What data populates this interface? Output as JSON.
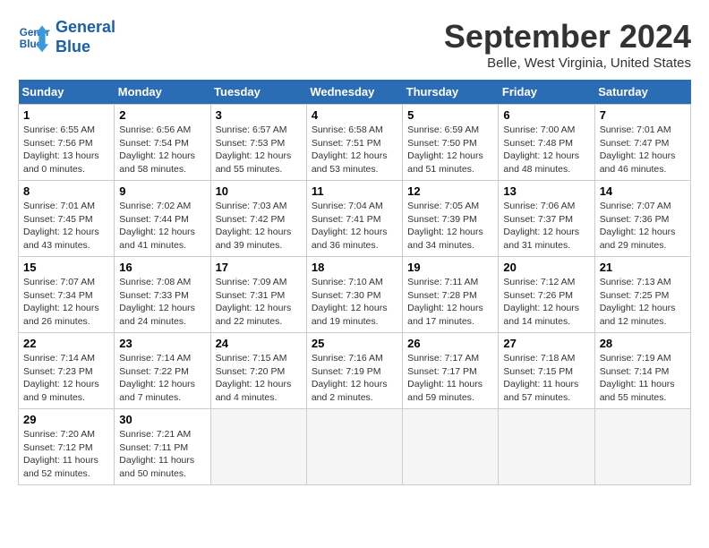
{
  "header": {
    "logo_line1": "General",
    "logo_line2": "Blue",
    "title": "September 2024",
    "subtitle": "Belle, West Virginia, United States"
  },
  "days_of_week": [
    "Sunday",
    "Monday",
    "Tuesday",
    "Wednesday",
    "Thursday",
    "Friday",
    "Saturday"
  ],
  "weeks": [
    [
      {
        "day": "1",
        "info": "Sunrise: 6:55 AM\nSunset: 7:56 PM\nDaylight: 13 hours\nand 0 minutes."
      },
      {
        "day": "2",
        "info": "Sunrise: 6:56 AM\nSunset: 7:54 PM\nDaylight: 12 hours\nand 58 minutes."
      },
      {
        "day": "3",
        "info": "Sunrise: 6:57 AM\nSunset: 7:53 PM\nDaylight: 12 hours\nand 55 minutes."
      },
      {
        "day": "4",
        "info": "Sunrise: 6:58 AM\nSunset: 7:51 PM\nDaylight: 12 hours\nand 53 minutes."
      },
      {
        "day": "5",
        "info": "Sunrise: 6:59 AM\nSunset: 7:50 PM\nDaylight: 12 hours\nand 51 minutes."
      },
      {
        "day": "6",
        "info": "Sunrise: 7:00 AM\nSunset: 7:48 PM\nDaylight: 12 hours\nand 48 minutes."
      },
      {
        "day": "7",
        "info": "Sunrise: 7:01 AM\nSunset: 7:47 PM\nDaylight: 12 hours\nand 46 minutes."
      }
    ],
    [
      {
        "day": "8",
        "info": "Sunrise: 7:01 AM\nSunset: 7:45 PM\nDaylight: 12 hours\nand 43 minutes."
      },
      {
        "day": "9",
        "info": "Sunrise: 7:02 AM\nSunset: 7:44 PM\nDaylight: 12 hours\nand 41 minutes."
      },
      {
        "day": "10",
        "info": "Sunrise: 7:03 AM\nSunset: 7:42 PM\nDaylight: 12 hours\nand 39 minutes."
      },
      {
        "day": "11",
        "info": "Sunrise: 7:04 AM\nSunset: 7:41 PM\nDaylight: 12 hours\nand 36 minutes."
      },
      {
        "day": "12",
        "info": "Sunrise: 7:05 AM\nSunset: 7:39 PM\nDaylight: 12 hours\nand 34 minutes."
      },
      {
        "day": "13",
        "info": "Sunrise: 7:06 AM\nSunset: 7:37 PM\nDaylight: 12 hours\nand 31 minutes."
      },
      {
        "day": "14",
        "info": "Sunrise: 7:07 AM\nSunset: 7:36 PM\nDaylight: 12 hours\nand 29 minutes."
      }
    ],
    [
      {
        "day": "15",
        "info": "Sunrise: 7:07 AM\nSunset: 7:34 PM\nDaylight: 12 hours\nand 26 minutes."
      },
      {
        "day": "16",
        "info": "Sunrise: 7:08 AM\nSunset: 7:33 PM\nDaylight: 12 hours\nand 24 minutes."
      },
      {
        "day": "17",
        "info": "Sunrise: 7:09 AM\nSunset: 7:31 PM\nDaylight: 12 hours\nand 22 minutes."
      },
      {
        "day": "18",
        "info": "Sunrise: 7:10 AM\nSunset: 7:30 PM\nDaylight: 12 hours\nand 19 minutes."
      },
      {
        "day": "19",
        "info": "Sunrise: 7:11 AM\nSunset: 7:28 PM\nDaylight: 12 hours\nand 17 minutes."
      },
      {
        "day": "20",
        "info": "Sunrise: 7:12 AM\nSunset: 7:26 PM\nDaylight: 12 hours\nand 14 minutes."
      },
      {
        "day": "21",
        "info": "Sunrise: 7:13 AM\nSunset: 7:25 PM\nDaylight: 12 hours\nand 12 minutes."
      }
    ],
    [
      {
        "day": "22",
        "info": "Sunrise: 7:14 AM\nSunset: 7:23 PM\nDaylight: 12 hours\nand 9 minutes."
      },
      {
        "day": "23",
        "info": "Sunrise: 7:14 AM\nSunset: 7:22 PM\nDaylight: 12 hours\nand 7 minutes."
      },
      {
        "day": "24",
        "info": "Sunrise: 7:15 AM\nSunset: 7:20 PM\nDaylight: 12 hours\nand 4 minutes."
      },
      {
        "day": "25",
        "info": "Sunrise: 7:16 AM\nSunset: 7:19 PM\nDaylight: 12 hours\nand 2 minutes."
      },
      {
        "day": "26",
        "info": "Sunrise: 7:17 AM\nSunset: 7:17 PM\nDaylight: 11 hours\nand 59 minutes."
      },
      {
        "day": "27",
        "info": "Sunrise: 7:18 AM\nSunset: 7:15 PM\nDaylight: 11 hours\nand 57 minutes."
      },
      {
        "day": "28",
        "info": "Sunrise: 7:19 AM\nSunset: 7:14 PM\nDaylight: 11 hours\nand 55 minutes."
      }
    ],
    [
      {
        "day": "29",
        "info": "Sunrise: 7:20 AM\nSunset: 7:12 PM\nDaylight: 11 hours\nand 52 minutes."
      },
      {
        "day": "30",
        "info": "Sunrise: 7:21 AM\nSunset: 7:11 PM\nDaylight: 11 hours\nand 50 minutes."
      },
      null,
      null,
      null,
      null,
      null
    ]
  ]
}
